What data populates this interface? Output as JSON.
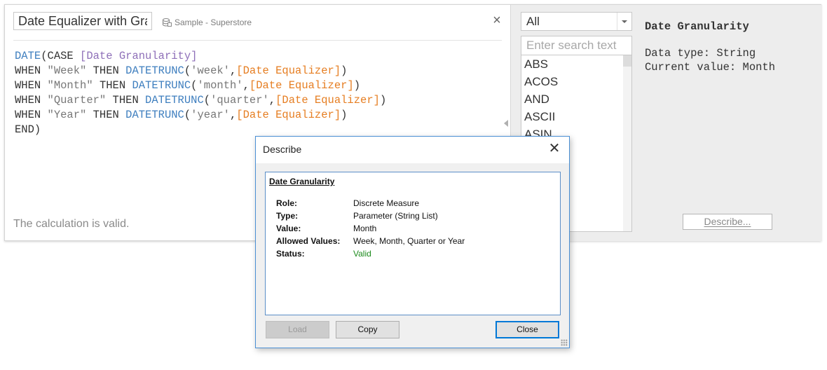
{
  "calc_editor": {
    "name": "Date Equalizer with Granularity",
    "datasource": "Sample - Superstore",
    "code_lines": [
      [
        {
          "t": "DATE",
          "c": "fn"
        },
        {
          "t": "(CASE ",
          "c": "plain"
        },
        {
          "t": "[Date Granularity]",
          "c": "prm"
        }
      ],
      [
        {
          "t": "WHEN ",
          "c": "plain"
        },
        {
          "t": "\"Week\"",
          "c": "str"
        },
        {
          "t": " THEN ",
          "c": "plain"
        },
        {
          "t": "DATETRUNC",
          "c": "fn"
        },
        {
          "t": "(",
          "c": "plain"
        },
        {
          "t": "'week'",
          "c": "str"
        },
        {
          "t": ",",
          "c": "plain"
        },
        {
          "t": "[Date Equalizer]",
          "c": "fld"
        },
        {
          "t": ")",
          "c": "plain"
        }
      ],
      [
        {
          "t": "WHEN ",
          "c": "plain"
        },
        {
          "t": "\"Month\"",
          "c": "str"
        },
        {
          "t": " THEN ",
          "c": "plain"
        },
        {
          "t": "DATETRUNC",
          "c": "fn"
        },
        {
          "t": "(",
          "c": "plain"
        },
        {
          "t": "'month'",
          "c": "str"
        },
        {
          "t": ",",
          "c": "plain"
        },
        {
          "t": "[Date Equalizer]",
          "c": "fld"
        },
        {
          "t": ")",
          "c": "plain"
        }
      ],
      [
        {
          "t": "WHEN ",
          "c": "plain"
        },
        {
          "t": "\"Quarter\"",
          "c": "str"
        },
        {
          "t": " THEN ",
          "c": "plain"
        },
        {
          "t": "DATETRUNC",
          "c": "fn"
        },
        {
          "t": "(",
          "c": "plain"
        },
        {
          "t": "'quarter'",
          "c": "str"
        },
        {
          "t": ",",
          "c": "plain"
        },
        {
          "t": "[Date Equalizer]",
          "c": "fld"
        },
        {
          "t": ")",
          "c": "plain"
        }
      ],
      [
        {
          "t": "WHEN ",
          "c": "plain"
        },
        {
          "t": "\"Year\"",
          "c": "str"
        },
        {
          "t": " THEN ",
          "c": "plain"
        },
        {
          "t": "DATETRUNC",
          "c": "fn"
        },
        {
          "t": "(",
          "c": "plain"
        },
        {
          "t": "'year'",
          "c": "str"
        },
        {
          "t": ",",
          "c": "plain"
        },
        {
          "t": "[Date Equalizer]",
          "c": "fld"
        },
        {
          "t": ")",
          "c": "plain"
        }
      ],
      [
        {
          "t": "END)",
          "c": "plain"
        }
      ]
    ],
    "validation": "The calculation is valid."
  },
  "function_panel": {
    "category_selected": "All",
    "search_placeholder": "Enter search text",
    "functions": [
      "ABS",
      "ACOS",
      "AND",
      "ASCII",
      "ASIN"
    ]
  },
  "help_panel": {
    "title": "Date Granularity",
    "data_type": "Data type: String",
    "current_value": "Current value: Month",
    "describe_button": "Describe..."
  },
  "describe_dialog": {
    "title": "Describe",
    "heading": "Date Granularity",
    "rows": [
      {
        "key": "Role:",
        "value": "Discrete Measure"
      },
      {
        "key": "Type:",
        "value": "Parameter (String List)"
      },
      {
        "key": "Value:",
        "value": "Month"
      },
      {
        "key": "Allowed Values:",
        "value": "Week, Month, Quarter or Year"
      },
      {
        "key": "Status:",
        "value": "Valid"
      }
    ],
    "buttons": {
      "load": "Load",
      "copy": "Copy",
      "close": "Close"
    }
  },
  "colors": {
    "function": "#3f7fbf",
    "field": "#e67e22",
    "parameter": "#8e6fb8",
    "string": "#777777",
    "status_valid": "#1c8a1c",
    "dialog_border": "#4a8fd4"
  }
}
